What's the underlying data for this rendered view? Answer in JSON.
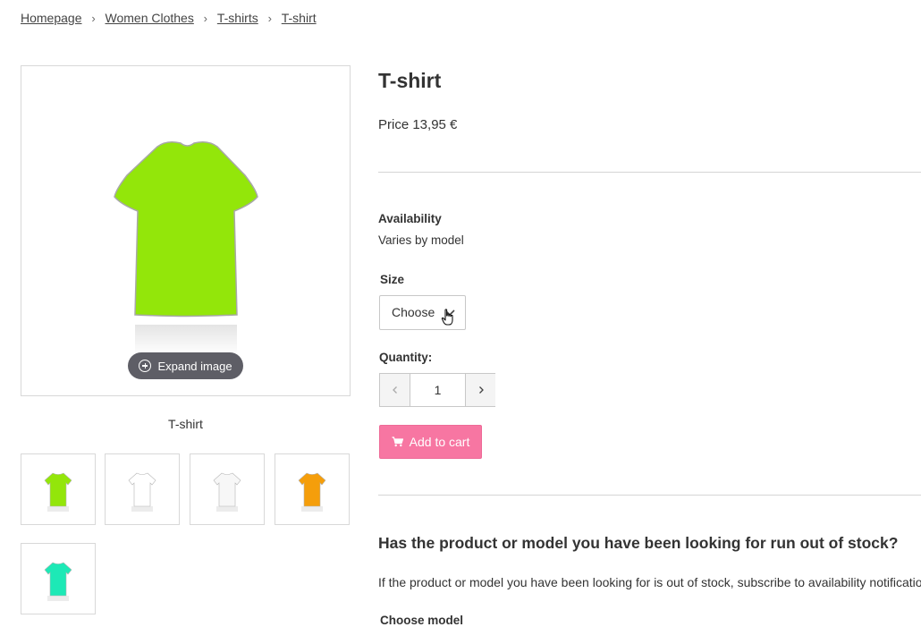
{
  "breadcrumb": {
    "items": [
      "Homepage",
      "Women Clothes",
      "T-shirts",
      "T-shirt"
    ],
    "separator": "›"
  },
  "gallery": {
    "main_image_color": "#93e60a",
    "expand_label": "Expand image",
    "caption": "T-shirt",
    "thumbnails": [
      {
        "color": "#93e60a"
      },
      {
        "color": "#ffffff"
      },
      {
        "color": "#f7f7f7"
      },
      {
        "color": "#f59e0b"
      },
      {
        "color": "#1de9b6"
      }
    ]
  },
  "product": {
    "title": "T-shirt",
    "price": "Price 13,95 €"
  },
  "availability": {
    "label": "Availability",
    "value": "Varies by model"
  },
  "size": {
    "label": "Size",
    "selected": "Choose"
  },
  "quantity": {
    "label": "Quantity:",
    "value": "1"
  },
  "cart": {
    "label": "Add to cart",
    "color": "#f776a2"
  },
  "out_of_stock": {
    "title": "Has the product or model you have been looking for run out of stock?",
    "text": "If the product or model you have been looking for is out of stock, subscribe to availability notifications.",
    "choose_model_label": "Choose model"
  }
}
